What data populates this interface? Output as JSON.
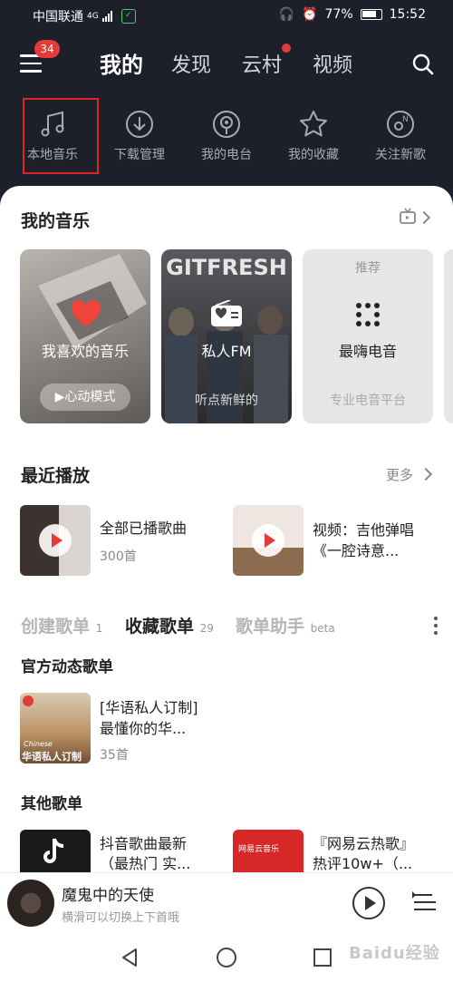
{
  "status": {
    "carrier": "中国联通",
    "network": "4G",
    "battery": "77%",
    "time": "15:52"
  },
  "header": {
    "notification_badge": "34",
    "tabs": [
      {
        "label": "我的",
        "active": true
      },
      {
        "label": "发现",
        "active": false
      },
      {
        "label": "云村",
        "active": false,
        "dot": true
      },
      {
        "label": "视频",
        "active": false
      }
    ]
  },
  "quick_actions": [
    {
      "label": "本地音乐",
      "icon": "music-note-icon",
      "highlighted": true
    },
    {
      "label": "下载管理",
      "icon": "download-icon"
    },
    {
      "label": "我的电台",
      "icon": "podcast-icon"
    },
    {
      "label": "我的收藏",
      "icon": "star-icon"
    },
    {
      "label": "关注新歌",
      "icon": "new-song-icon"
    }
  ],
  "my_music": {
    "title": "我的音乐",
    "tiles": [
      {
        "label": "我喜欢的音乐",
        "button": "▶心动模式"
      },
      {
        "label": "私人FM",
        "sub": "听点新鲜的",
        "cover_text": "GITFRESH"
      },
      {
        "top": "推荐",
        "label": "最嗨电音",
        "sub": "专业电音平台"
      }
    ]
  },
  "recent": {
    "title": "最近播放",
    "more": "更多",
    "items": [
      {
        "title": "全部已播歌曲",
        "sub": "300首"
      },
      {
        "title_line1": "视频：吉他弹唱",
        "title_line2": "《一腔诗意..."
      }
    ]
  },
  "playlist_tabs": [
    {
      "label": "创建歌单",
      "count": "1",
      "active": false
    },
    {
      "label": "收藏歌单",
      "count": "29",
      "active": true
    },
    {
      "label": "歌单助手",
      "count": "beta",
      "active": false
    }
  ],
  "official": {
    "title": "官方动态歌单",
    "item": {
      "line1": "[华语私人订制]",
      "line2": "最懂你的华...",
      "sub": "35首",
      "cover_line1": "Chinese",
      "cover_line2": "华语私人订制"
    }
  },
  "other": {
    "title": "其他歌单",
    "items": [
      {
        "line1": "抖音歌曲最新",
        "line2": "（最热门 实..."
      },
      {
        "line1": "『网易云热歌』",
        "line2": "热评10w+（...",
        "cover_text": "网易云音乐"
      }
    ]
  },
  "player": {
    "title": "魔鬼中的天使",
    "subtitle": "横滑可以切换上下首哦"
  },
  "watermark": "Baidu经验",
  "colors": {
    "accent": "#e33a3a",
    "dark_bg": "#1d1f2b",
    "highlight_box": "#e02424"
  }
}
